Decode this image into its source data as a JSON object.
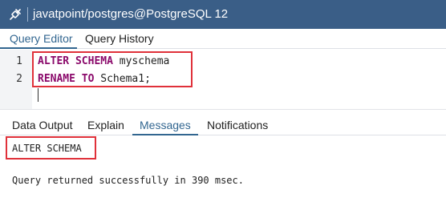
{
  "window": {
    "title": "javatpoint/postgres@PostgreSQL 12",
    "icon": "plug-icon"
  },
  "top_tabs": [
    {
      "label": "Query Editor",
      "active": true
    },
    {
      "label": "Query History",
      "active": false
    }
  ],
  "editor": {
    "lines": [
      {
        "number": "1",
        "keyword1": "ALTER",
        "keyword2": "SCHEMA",
        "text": "myschema"
      },
      {
        "number": "2",
        "keyword1": "RENAME",
        "keyword2": "TO",
        "text": "Schema1;"
      }
    ]
  },
  "bottom_tabs": [
    {
      "label": "Data Output",
      "active": false
    },
    {
      "label": "Explain",
      "active": false
    },
    {
      "label": "Messages",
      "active": true
    },
    {
      "label": "Notifications",
      "active": false
    }
  ],
  "messages": {
    "result": "ALTER SCHEMA",
    "status": "Query returned successfully in 390 msec."
  },
  "colors": {
    "titlebar": "#3a5e87",
    "active_tab": "#326690",
    "keyword": "#8b0a6b",
    "highlight_box": "#e0313a"
  }
}
